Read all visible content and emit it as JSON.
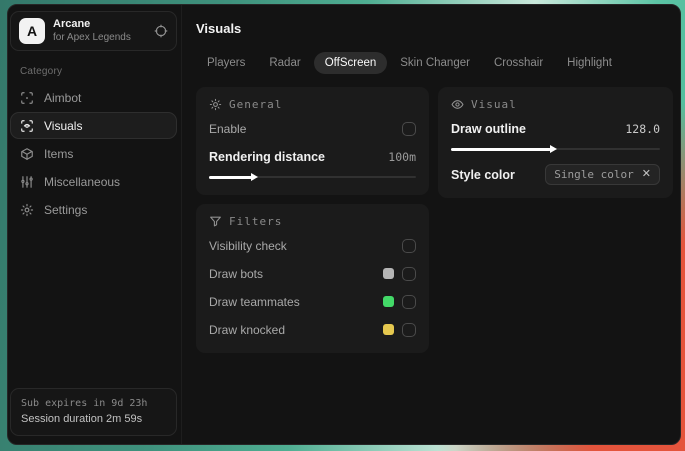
{
  "sidebar": {
    "logo_letter": "A",
    "app_name": "Arcane",
    "app_subtitle": "for Apex Legends",
    "category_label": "Category",
    "items": [
      {
        "label": "Aimbot"
      },
      {
        "label": "Visuals"
      },
      {
        "label": "Items"
      },
      {
        "label": "Miscellaneous"
      },
      {
        "label": "Settings"
      }
    ],
    "active_item": "Visuals",
    "footer": {
      "sub_expires": "Sub expires in 9d 23h",
      "session_duration": "Session duration 2m 59s"
    }
  },
  "header": {
    "title": "Visuals"
  },
  "tabs": {
    "items": [
      "Players",
      "Radar",
      "OffScreen",
      "Skin Changer",
      "Crosshair",
      "Highlight"
    ],
    "active": "OffScreen"
  },
  "panels": {
    "general": {
      "title": "General",
      "enable_label": "Enable",
      "enable_checked": false,
      "rendering_distance_label": "Rendering distance",
      "rendering_distance_value": "100m",
      "rendering_distance_percent": 21
    },
    "filters": {
      "title": "Filters",
      "rows": [
        {
          "label": "Visibility check",
          "checked": false
        },
        {
          "label": "Draw bots",
          "swatch": "#b5b5b5",
          "checked": false
        },
        {
          "label": "Draw teammates",
          "swatch": "#43d968",
          "checked": false
        },
        {
          "label": "Draw knocked",
          "swatch": "#e5c84f",
          "checked": false
        }
      ]
    },
    "visual": {
      "title": "Visual",
      "draw_outline_label": "Draw outline",
      "draw_outline_value": "128.0",
      "draw_outline_percent": 48,
      "style_color_label": "Style color",
      "style_color_value": "Single color",
      "clear_icon": "✕"
    }
  }
}
